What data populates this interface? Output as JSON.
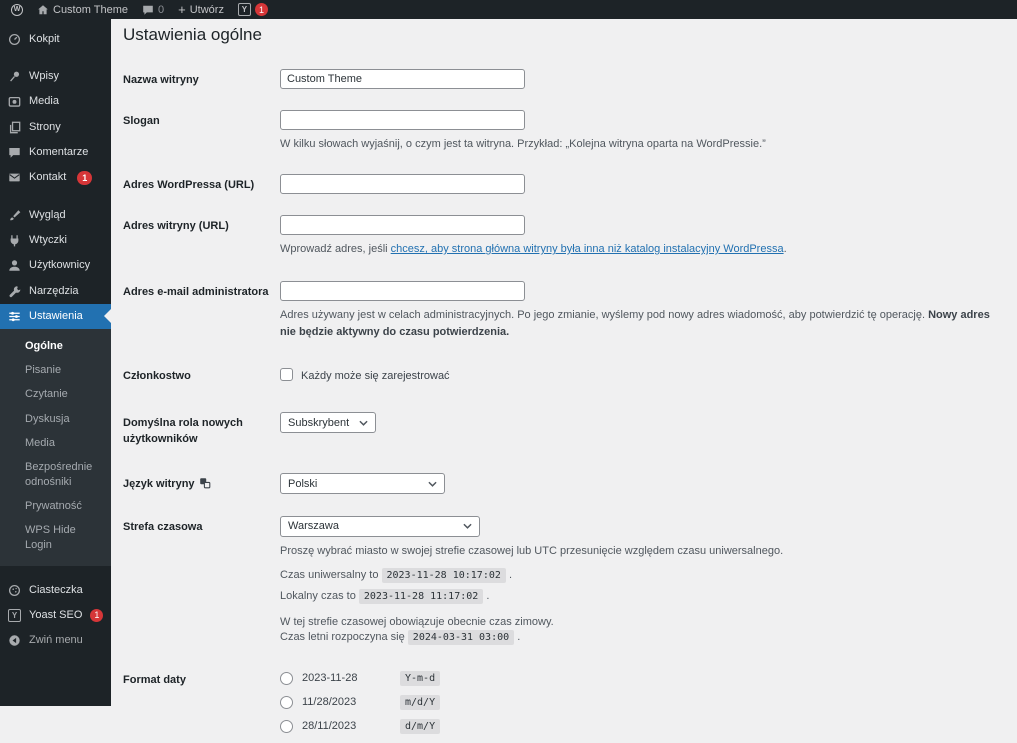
{
  "colors": {
    "accent": "#2271b1",
    "badge_red": "#d63638",
    "sidebar_bg": "#1d2327",
    "submenu_bg": "#2c3338",
    "content_bg": "#f0f0f1",
    "link": "#2271b1"
  },
  "admin_bar": {
    "wp_logo_letter": "W",
    "site_name": "Custom Theme",
    "comments_count": "0",
    "plus_glyph": "+",
    "new_label": "Utwórz",
    "yoast_letter": "Y",
    "yoast_badge": "1"
  },
  "sidebar": {
    "items": [
      {
        "label": "Kokpit"
      },
      {
        "label": "Wpisy"
      },
      {
        "label": "Media"
      },
      {
        "label": "Strony"
      },
      {
        "label": "Komentarze"
      },
      {
        "label": "Kontakt",
        "badge": "1"
      },
      {
        "label": "Wygląd"
      },
      {
        "label": "Wtyczki"
      },
      {
        "label": "Użytkownicy"
      },
      {
        "label": "Narzędzia"
      },
      {
        "label": "Ustawienia"
      }
    ],
    "settings_submenu": [
      {
        "label": "Ogólne"
      },
      {
        "label": "Pisanie"
      },
      {
        "label": "Czytanie"
      },
      {
        "label": "Dyskusja"
      },
      {
        "label": "Media"
      },
      {
        "label": "Bezpośrednie odnośniki"
      },
      {
        "label": "Prywatność"
      },
      {
        "label": "WPS Hide Login"
      }
    ],
    "footer_items": [
      {
        "label": "Ciasteczka"
      },
      {
        "label": "Yoast SEO",
        "badge": "1",
        "icon_letter": "Y"
      },
      {
        "label": "Zwiń menu"
      }
    ]
  },
  "main": {
    "title": "Ustawienia ogólne",
    "site_title": {
      "label": "Nazwa witryny",
      "value": "Custom Theme"
    },
    "tagline": {
      "label": "Slogan",
      "value": "",
      "desc": "W kilku słowach wyjaśnij, o czym jest ta witryna. Przykład: „Kolejna witryna oparta na WordPressie.”"
    },
    "wp_url": {
      "label": "Adres WordPressa (URL)",
      "value": ""
    },
    "site_url": {
      "label": "Adres witryny (URL)",
      "value": "",
      "desc_prefix": "Wprowadź adres, jeśli ",
      "desc_link": "chcesz, aby strona główna witryny była inna niż katalog instalacyjny WordPressa",
      "desc_suffix": "."
    },
    "admin_email": {
      "label": "Adres e-mail administratora",
      "value": "",
      "desc_normal": "Adres używany jest w celach administracyjnych. Po jego zmianie, wyślemy pod nowy adres wiadomość, aby potwierdzić tę operację. ",
      "desc_bold": "Nowy adres nie będzie aktywny do czasu potwierdzenia."
    },
    "membership": {
      "label": "Członkostwo",
      "checkbox_label": "Każdy może się zarejestrować"
    },
    "default_role": {
      "label": "Domyślna rola nowych użytkowników",
      "value": "Subskrybent"
    },
    "language": {
      "label": "Język witryny",
      "value": "Polski"
    },
    "timezone": {
      "label": "Strefa czasowa",
      "value": "Warszawa",
      "desc": "Proszę wybrać miasto w swojej strefie czasowej lub UTC przesunięcie względem czasu uniwersalnego.",
      "utc_prefix": "Czas uniwersalny to",
      "utc_time": "2023-11-28 10:17:02",
      "utc_suffix": ".",
      "local_prefix": "Lokalny czas to",
      "local_time": "2023-11-28 11:17:02",
      "local_suffix": ".",
      "dst_note": "W tej strefie czasowej obowiązuje obecnie czas zimowy.",
      "dst_prefix": "Czas letni rozpoczyna się",
      "dst_time": "2024-03-31 03:00",
      "dst_suffix": "."
    },
    "date_format": {
      "label": "Format daty",
      "options": [
        {
          "example": "2023-11-28",
          "format": "Y-m-d"
        },
        {
          "example": "11/28/2023",
          "format": "m/d/Y"
        },
        {
          "example": "28/11/2023",
          "format": "d/m/Y"
        }
      ]
    }
  }
}
